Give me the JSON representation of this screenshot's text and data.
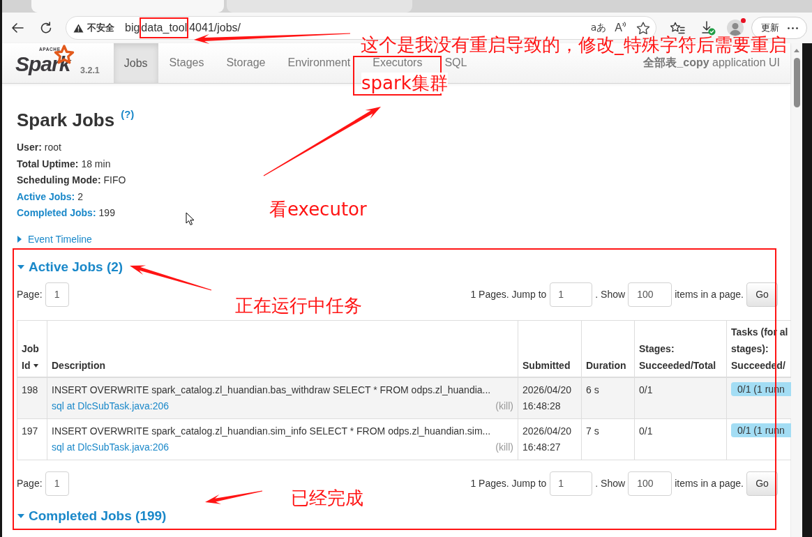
{
  "browser": {
    "tabs": [
      {
        "selected": true
      },
      {
        "selected": false
      }
    ],
    "address_bar": {
      "security_label": "不安全",
      "url_parts": [
        {
          "text": "big",
          "boxed": false
        },
        {
          "text": "data_tool",
          "boxed": true
        },
        {
          "text": "4041/jobs/",
          "boxed": false
        }
      ],
      "translate_glyph": "aあ",
      "read_aloud_glyph": "A"
    },
    "update_button": "更新"
  },
  "spark_ui": {
    "logo": {
      "vendor": "APACHE",
      "name": "Spark"
    },
    "version": "3.2.1",
    "nav": [
      {
        "label": "Jobs",
        "selected": true
      },
      {
        "label": "Stages",
        "selected": false
      },
      {
        "label": "Storage",
        "selected": false
      },
      {
        "label": "Environment",
        "selected": false
      },
      {
        "label": "Executors",
        "selected": false
      },
      {
        "label": "SQL",
        "selected": false
      }
    ],
    "app_name": "**全部表_copy** application UI"
  },
  "page": {
    "title": "Spark Jobs",
    "help": "(?)",
    "summary": [
      {
        "label": "User:",
        "value": "root",
        "link": false
      },
      {
        "label": "Total Uptime:",
        "value": "18 min",
        "link": false
      },
      {
        "label": "Scheduling Mode:",
        "value": "FIFO",
        "link": false
      },
      {
        "label": "Active Jobs:",
        "value": "2",
        "link": true
      },
      {
        "label": "Completed Jobs:",
        "value": "199",
        "link": true
      }
    ],
    "event_timeline": {
      "label": "Event Timeline",
      "expanded": false
    },
    "sections": [
      {
        "title": "Active Jobs (2)",
        "expanded": true,
        "pager_top": {
          "page_label": "Page:",
          "page": "1",
          "pages_text": "1 Pages. Jump to",
          "jump_value": "1",
          "show_text": ". Show",
          "show_value": "100",
          "suffix": "items in a page.",
          "button": "Go"
        },
        "table": {
          "columns": [
            {
              "label": "Job Id",
              "sorted": true
            },
            {
              "label": "Description",
              "sorted": false
            },
            {
              "label": "Submitted",
              "sorted": false
            },
            {
              "label": "Duration",
              "sorted": false
            },
            {
              "label": "Stages: Succeeded/Total",
              "sorted": false
            },
            {
              "label": "Tasks (for al stages): Succeeded/",
              "sorted": false
            }
          ],
          "rows": [
            {
              "job_id": "198",
              "description": "INSERT OVERWRITE spark_catalog.zl_huandian.bas_withdraw SELECT * FROM odps.zl_huandia...",
              "call_site": "sql at DlcSubTask.java:206",
              "kill": "(kill)",
              "submitted": "2026/04/20 16:48:28",
              "duration": "6 s",
              "stages": "0/1",
              "tasks": {
                "label": "0/1 (1 runn",
                "level": 1
              }
            },
            {
              "job_id": "197",
              "description": "INSERT OVERWRITE spark_catalog.zl_huandian.sim_info SELECT * FROM odps.zl_huandian.sim...",
              "call_site": "sql at DlcSubTask.java:206",
              "kill": "(kill)",
              "submitted": "2026/04/20 16:48:27",
              "duration": "7 s",
              "stages": "0/1",
              "tasks": {
                "label": "0/1 (1 runn",
                "level": 1
              }
            }
          ]
        },
        "pager_bottom": {
          "page_label": "Page:",
          "page": "1",
          "pages_text": "1 Pages. Jump to",
          "jump_value": "1",
          "show_text": ". Show",
          "show_value": "100",
          "suffix": "items in a page.",
          "button": "Go"
        }
      },
      {
        "title": "Completed Jobs (199)",
        "expanded": true
      }
    ]
  },
  "annotations": [
    {
      "kind": "arrow"
    },
    {
      "kind": "note",
      "text": "这个是我没有重启导致的，修改_特殊字符后需要重启"
    },
    {
      "kind": "boxed_note",
      "text": "spark集群"
    },
    {
      "kind": "arrow"
    },
    {
      "kind": "note",
      "text": "看executor"
    },
    {
      "kind": "box"
    },
    {
      "kind": "arrow"
    },
    {
      "kind": "note",
      "text": "正在运行中任务"
    },
    {
      "kind": "arrow"
    },
    {
      "kind": "note",
      "text": "已经完成"
    }
  ]
}
